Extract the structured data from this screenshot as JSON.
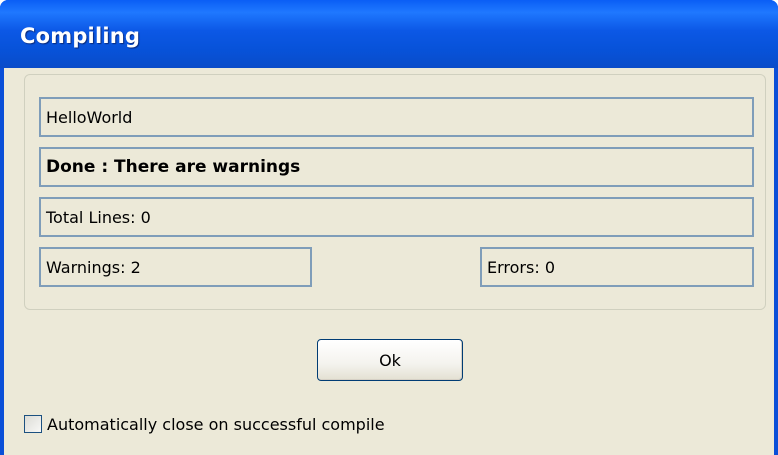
{
  "window": {
    "title": "Compiling"
  },
  "status": {
    "project_name": "HelloWorld",
    "message": "Done : There are warnings",
    "total_lines": "Total Lines: 0",
    "warnings": "Warnings: 2",
    "errors": "Errors: 0"
  },
  "actions": {
    "ok_label": "Ok"
  },
  "options": {
    "auto_close_label": "Automatically close on successful compile",
    "auto_close_checked": false
  }
}
